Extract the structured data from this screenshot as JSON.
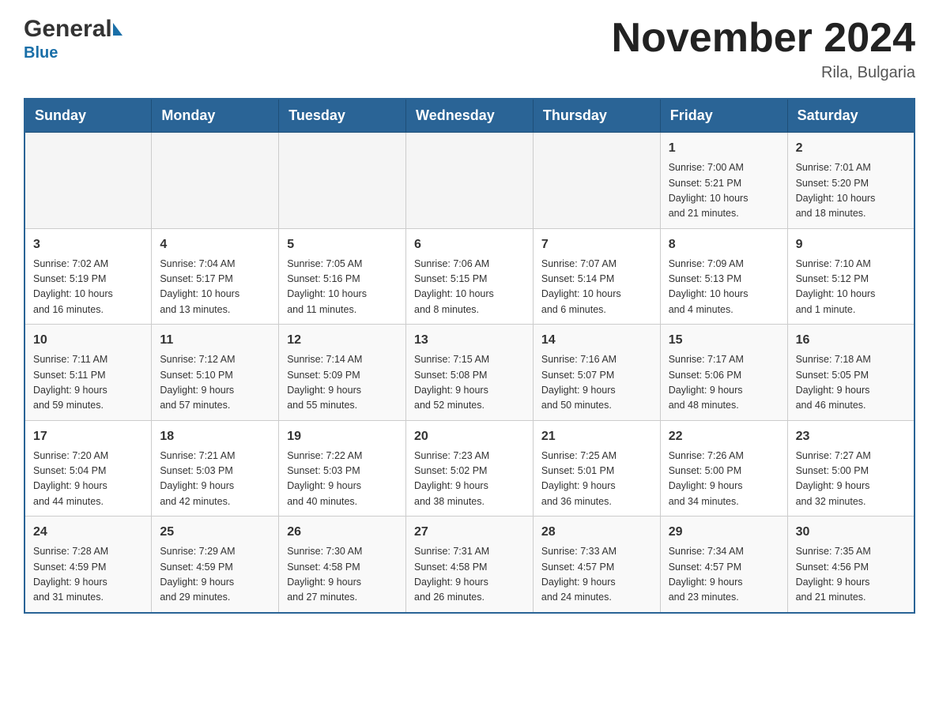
{
  "header": {
    "logo_general": "General",
    "logo_blue": "Blue",
    "month_title": "November 2024",
    "location": "Rila, Bulgaria"
  },
  "days_of_week": [
    "Sunday",
    "Monday",
    "Tuesday",
    "Wednesday",
    "Thursday",
    "Friday",
    "Saturday"
  ],
  "weeks": [
    {
      "days": [
        {
          "num": "",
          "info": ""
        },
        {
          "num": "",
          "info": ""
        },
        {
          "num": "",
          "info": ""
        },
        {
          "num": "",
          "info": ""
        },
        {
          "num": "",
          "info": ""
        },
        {
          "num": "1",
          "info": "Sunrise: 7:00 AM\nSunset: 5:21 PM\nDaylight: 10 hours\nand 21 minutes."
        },
        {
          "num": "2",
          "info": "Sunrise: 7:01 AM\nSunset: 5:20 PM\nDaylight: 10 hours\nand 18 minutes."
        }
      ]
    },
    {
      "days": [
        {
          "num": "3",
          "info": "Sunrise: 7:02 AM\nSunset: 5:19 PM\nDaylight: 10 hours\nand 16 minutes."
        },
        {
          "num": "4",
          "info": "Sunrise: 7:04 AM\nSunset: 5:17 PM\nDaylight: 10 hours\nand 13 minutes."
        },
        {
          "num": "5",
          "info": "Sunrise: 7:05 AM\nSunset: 5:16 PM\nDaylight: 10 hours\nand 11 minutes."
        },
        {
          "num": "6",
          "info": "Sunrise: 7:06 AM\nSunset: 5:15 PM\nDaylight: 10 hours\nand 8 minutes."
        },
        {
          "num": "7",
          "info": "Sunrise: 7:07 AM\nSunset: 5:14 PM\nDaylight: 10 hours\nand 6 minutes."
        },
        {
          "num": "8",
          "info": "Sunrise: 7:09 AM\nSunset: 5:13 PM\nDaylight: 10 hours\nand 4 minutes."
        },
        {
          "num": "9",
          "info": "Sunrise: 7:10 AM\nSunset: 5:12 PM\nDaylight: 10 hours\nand 1 minute."
        }
      ]
    },
    {
      "days": [
        {
          "num": "10",
          "info": "Sunrise: 7:11 AM\nSunset: 5:11 PM\nDaylight: 9 hours\nand 59 minutes."
        },
        {
          "num": "11",
          "info": "Sunrise: 7:12 AM\nSunset: 5:10 PM\nDaylight: 9 hours\nand 57 minutes."
        },
        {
          "num": "12",
          "info": "Sunrise: 7:14 AM\nSunset: 5:09 PM\nDaylight: 9 hours\nand 55 minutes."
        },
        {
          "num": "13",
          "info": "Sunrise: 7:15 AM\nSunset: 5:08 PM\nDaylight: 9 hours\nand 52 minutes."
        },
        {
          "num": "14",
          "info": "Sunrise: 7:16 AM\nSunset: 5:07 PM\nDaylight: 9 hours\nand 50 minutes."
        },
        {
          "num": "15",
          "info": "Sunrise: 7:17 AM\nSunset: 5:06 PM\nDaylight: 9 hours\nand 48 minutes."
        },
        {
          "num": "16",
          "info": "Sunrise: 7:18 AM\nSunset: 5:05 PM\nDaylight: 9 hours\nand 46 minutes."
        }
      ]
    },
    {
      "days": [
        {
          "num": "17",
          "info": "Sunrise: 7:20 AM\nSunset: 5:04 PM\nDaylight: 9 hours\nand 44 minutes."
        },
        {
          "num": "18",
          "info": "Sunrise: 7:21 AM\nSunset: 5:03 PM\nDaylight: 9 hours\nand 42 minutes."
        },
        {
          "num": "19",
          "info": "Sunrise: 7:22 AM\nSunset: 5:03 PM\nDaylight: 9 hours\nand 40 minutes."
        },
        {
          "num": "20",
          "info": "Sunrise: 7:23 AM\nSunset: 5:02 PM\nDaylight: 9 hours\nand 38 minutes."
        },
        {
          "num": "21",
          "info": "Sunrise: 7:25 AM\nSunset: 5:01 PM\nDaylight: 9 hours\nand 36 minutes."
        },
        {
          "num": "22",
          "info": "Sunrise: 7:26 AM\nSunset: 5:00 PM\nDaylight: 9 hours\nand 34 minutes."
        },
        {
          "num": "23",
          "info": "Sunrise: 7:27 AM\nSunset: 5:00 PM\nDaylight: 9 hours\nand 32 minutes."
        }
      ]
    },
    {
      "days": [
        {
          "num": "24",
          "info": "Sunrise: 7:28 AM\nSunset: 4:59 PM\nDaylight: 9 hours\nand 31 minutes."
        },
        {
          "num": "25",
          "info": "Sunrise: 7:29 AM\nSunset: 4:59 PM\nDaylight: 9 hours\nand 29 minutes."
        },
        {
          "num": "26",
          "info": "Sunrise: 7:30 AM\nSunset: 4:58 PM\nDaylight: 9 hours\nand 27 minutes."
        },
        {
          "num": "27",
          "info": "Sunrise: 7:31 AM\nSunset: 4:58 PM\nDaylight: 9 hours\nand 26 minutes."
        },
        {
          "num": "28",
          "info": "Sunrise: 7:33 AM\nSunset: 4:57 PM\nDaylight: 9 hours\nand 24 minutes."
        },
        {
          "num": "29",
          "info": "Sunrise: 7:34 AM\nSunset: 4:57 PM\nDaylight: 9 hours\nand 23 minutes."
        },
        {
          "num": "30",
          "info": "Sunrise: 7:35 AM\nSunset: 4:56 PM\nDaylight: 9 hours\nand 21 minutes."
        }
      ]
    }
  ]
}
